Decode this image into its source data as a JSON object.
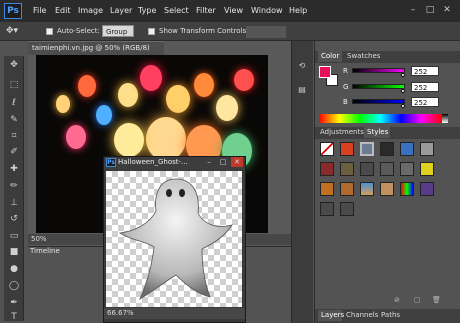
{
  "menubar": {
    "logo": "Ps",
    "items": [
      "File",
      "Edit",
      "Image",
      "Layer",
      "Type",
      "Select",
      "Filter",
      "View",
      "Window",
      "Help"
    ],
    "window_buttons": [
      "–",
      "□",
      "✕"
    ]
  },
  "options": {
    "auto_select_label": "Auto-Select:",
    "auto_select_value": "Group",
    "transform_label": "Show Transform Controls"
  },
  "document": {
    "tab_title": "taimienphi.vn.jpg @ 50% (RGB/8)",
    "zoom": "50%",
    "timeline_tab": "Timeline"
  },
  "ghost_window": {
    "title": "Halloween_Ghost-...",
    "zoom": "66.67%",
    "ps_badge": "Ps"
  },
  "panels": {
    "color_tabs": [
      "Color",
      "Swatches"
    ],
    "channels": [
      {
        "label": "R",
        "value": "252",
        "color": "#fc00fc",
        "fill": 0.99
      },
      {
        "label": "G",
        "value": "252",
        "color": "#00ff00",
        "fill": 0.99
      },
      {
        "label": "B",
        "value": "252",
        "color": "#0000ff",
        "fill": 0.99
      }
    ],
    "fg_color": "#e8105a",
    "styles_tabs": [
      "Adjustments",
      "Styles"
    ],
    "layers_tabs": [
      "Layers",
      "Channels",
      "Paths"
    ]
  },
  "colors": {
    "accent": "#3a8be0",
    "menubar": "#2b2b2b",
    "panel": "#535353"
  }
}
